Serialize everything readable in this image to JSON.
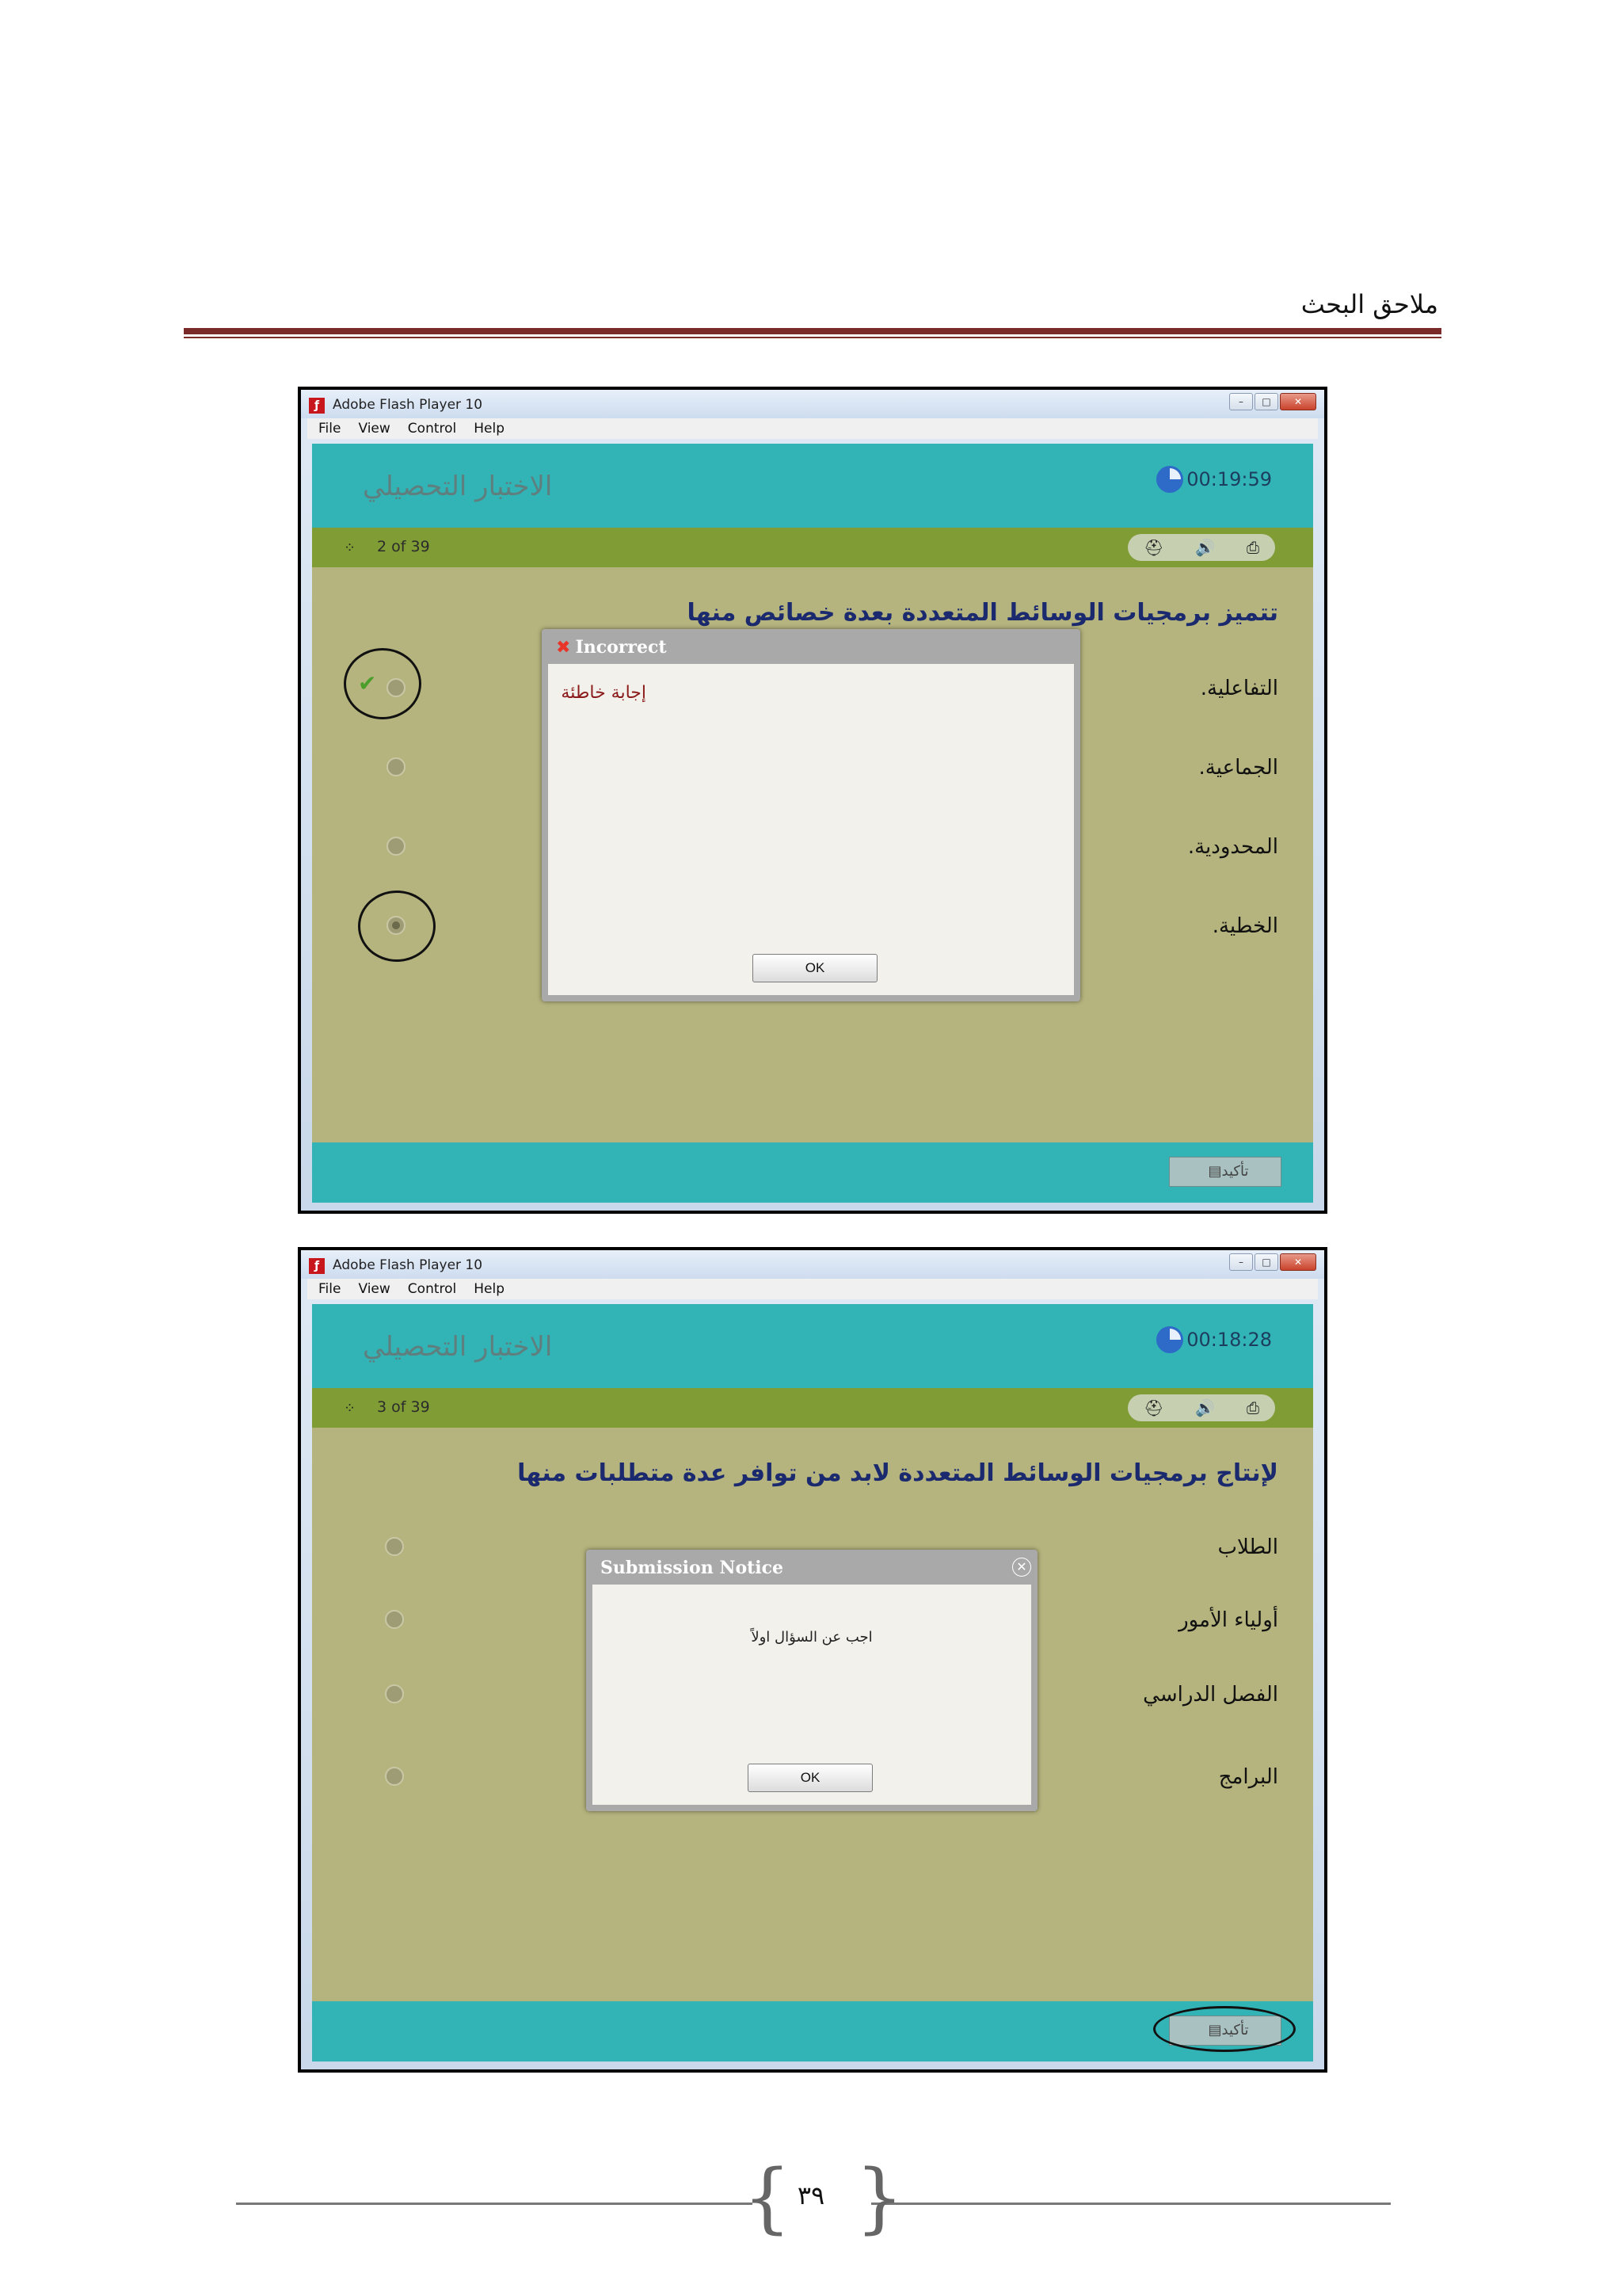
{
  "page": {
    "header_title": "ملاحق البحث",
    "page_number": "٣٩"
  },
  "windows": [
    {
      "title": "Adobe Flash Player 10",
      "menu": [
        "File",
        "View",
        "Control",
        "Help"
      ],
      "quiz_title": "الاختبار التحصيلي",
      "timer": "00:19:59",
      "progress": "2 of 39",
      "question": "تتميز برمجيات الوسائط المتعددة بعدة خصائص منها",
      "options": [
        "التفاعلية.",
        "الجماعية.",
        "المحدودية.",
        "الخطية."
      ],
      "confirm_label": "تأكيد",
      "dialog": {
        "title": "Incorrect",
        "message": "إجابة خاطئة",
        "ok": "OK"
      }
    },
    {
      "title": "Adobe Flash Player 10",
      "menu": [
        "File",
        "View",
        "Control",
        "Help"
      ],
      "quiz_title": "الاختبار التحصيلي",
      "timer": "00:18:28",
      "progress": "3 of 39",
      "question": "لإنتاج برمجيات الوسائط المتعددة لابد من توافر عدة متطلبات منها",
      "options": [
        "الطلاب",
        "أولياء الأمور",
        "الفصل الدراسي",
        "البرامج"
      ],
      "confirm_label": "تأكيد",
      "dialog": {
        "title": "Submission Notice",
        "message": "اجب عن السؤال اولاً",
        "ok": "OK"
      }
    }
  ],
  "colors": {
    "header_rule": "#7b2a2a",
    "teal": "#32b3b6",
    "olive_bar": "#7f9c35",
    "stage": "#b5b47e",
    "question_text": "#1b2a6e"
  }
}
